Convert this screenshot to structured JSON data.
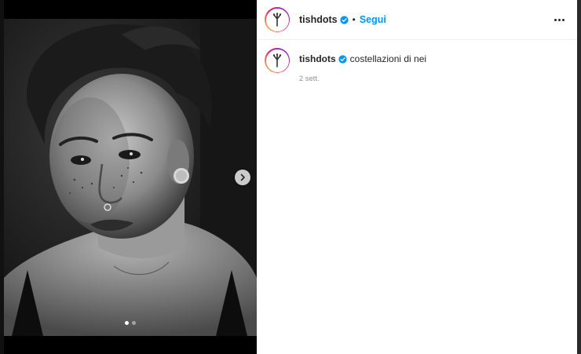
{
  "post": {
    "username": "tishdots",
    "separator": "•",
    "follow_label": "Segui",
    "caption_username": "tishdots",
    "caption_text": "costellazioni di nei",
    "time": "2 sett."
  },
  "carousel": {
    "total_slides": 2,
    "active_slide": 1
  },
  "colors": {
    "follow": "#0095f6",
    "verified": "#0095f6",
    "text": "#262626",
    "secondary": "#8e8e8e"
  },
  "icons": {
    "verified": "verified-badge-icon",
    "more": "more-options-icon",
    "next": "chevron-right-icon"
  }
}
